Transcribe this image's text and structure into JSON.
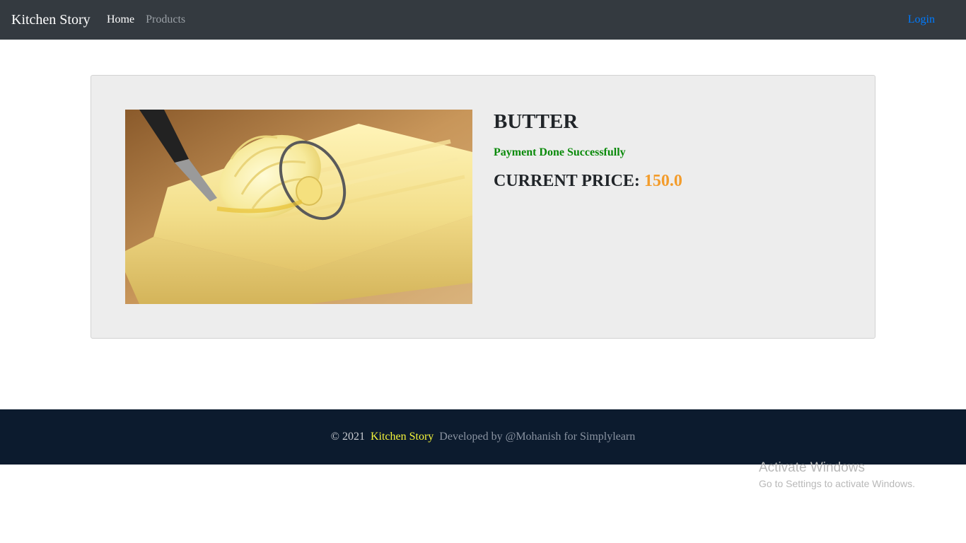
{
  "navbar": {
    "brand": "Kitchen Story",
    "links": [
      {
        "label": "Home",
        "active": true
      },
      {
        "label": "Products",
        "active": false
      }
    ],
    "login_label": "Login"
  },
  "product": {
    "image_alt": "butter",
    "title": "BUTTER",
    "payment_status": "Payment Done Successfully",
    "price_label": "CURRENT PRICE:",
    "price_value": "150.0"
  },
  "footer": {
    "copyright": "© 2021",
    "brand": "Kitchen Story",
    "developed_by": "Developed by @Mohanish for Simplylearn"
  },
  "watermark": {
    "title": "Activate Windows",
    "subtitle": "Go to Settings to activate Windows."
  },
  "colors": {
    "navbar_bg": "#343a40",
    "login_link": "#007bff",
    "success": "#0a8a0a",
    "price_accent": "#f39c2b",
    "footer_bg": "#0c1b2e",
    "footer_brand": "#f5f53a"
  }
}
